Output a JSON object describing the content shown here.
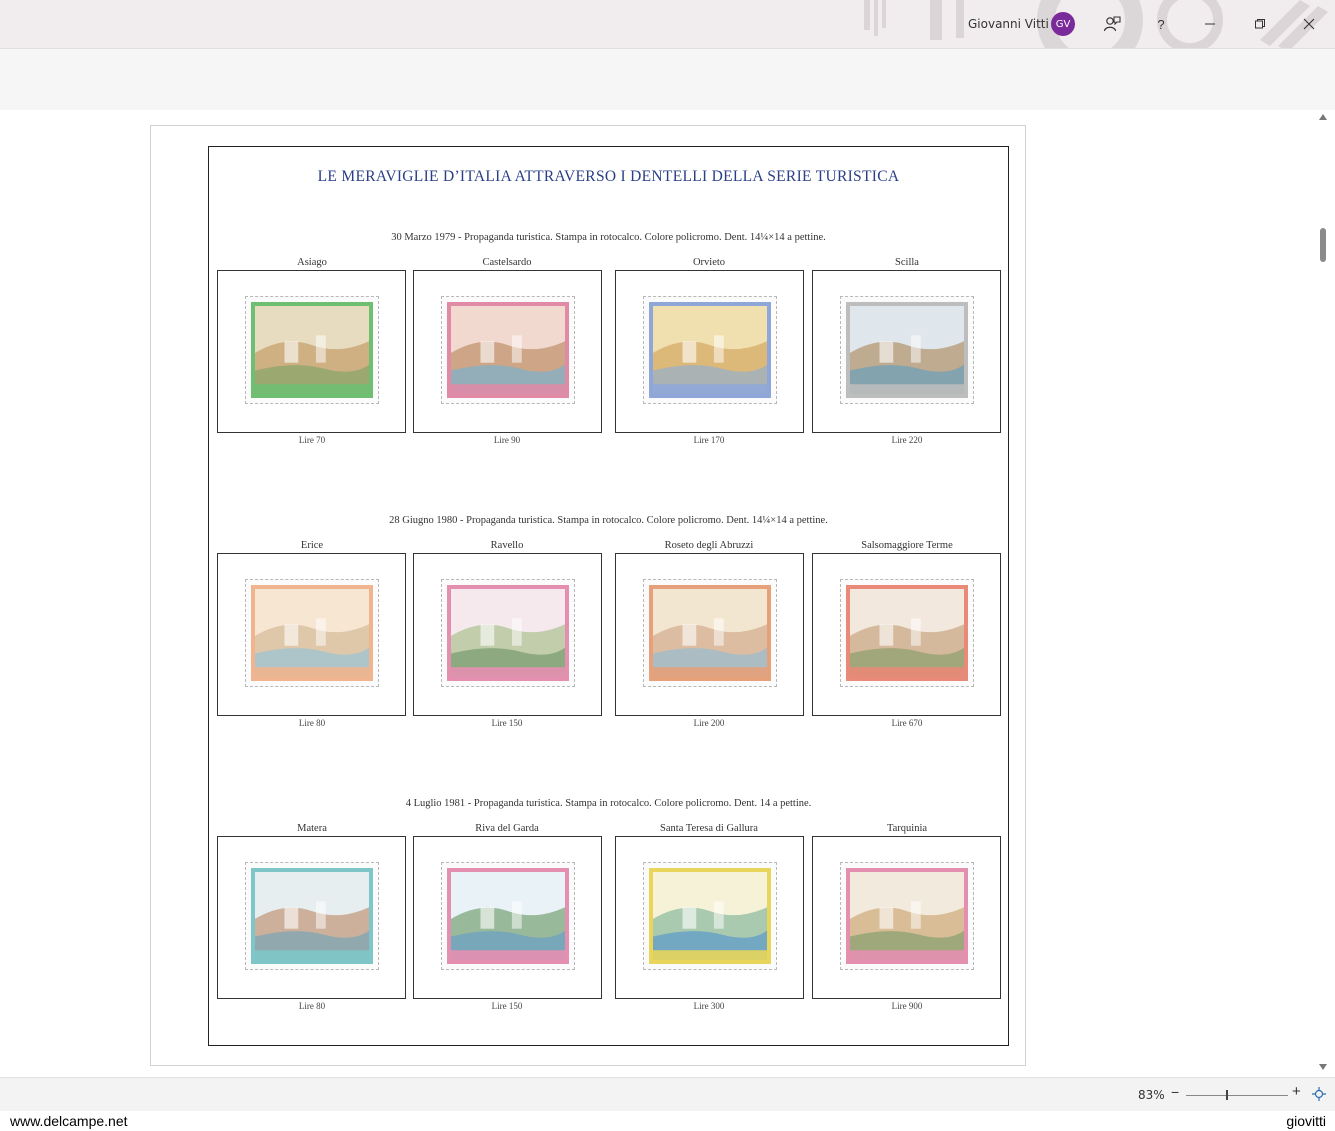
{
  "titlebar": {
    "user_name": "Giovanni Vitti",
    "avatar_initials": "GV",
    "icons": [
      "feedback-icon",
      "help-icon",
      "minimize-icon",
      "restore-icon",
      "close-icon"
    ],
    "help_glyph": "?",
    "avatar_color": "#7b2a9c"
  },
  "album": {
    "title": "LE MERAVIGLIE D’ITALIA ATTRAVERSO I DENTELLI DELLA SERIE TURISTICA",
    "title_color": "#2a3f86",
    "series": [
      {
        "caption": "30 Marzo 1979 - Propaganda turistica. Stampa in rotocalco. Colore policromo. Dent. 14¼×14 a pettine.",
        "stamps": [
          {
            "name": "Asiago",
            "value": "Lire 70",
            "frame_color": "#6fbf73"
          },
          {
            "name": "Castelsardo",
            "value": "Lire 90",
            "frame_color": "#e08aa6"
          },
          {
            "name": "Orvieto",
            "value": "Lire 170",
            "frame_color": "#8fa6d8"
          },
          {
            "name": "Scilla",
            "value": "Lire 220",
            "frame_color": "#bdbdbd"
          }
        ]
      },
      {
        "caption": "28 Giugno 1980 - Propaganda turistica. Stampa in rotocalco. Colore policromo. Dent. 14¼×14 a pettine.",
        "stamps": [
          {
            "name": "Erice",
            "value": "Lire 80",
            "frame_color": "#f0b58e"
          },
          {
            "name": "Ravello",
            "value": "Lire 150",
            "frame_color": "#e58fb0"
          },
          {
            "name": "Roseto degli Abruzzi",
            "value": "Lire 200",
            "frame_color": "#e6a07a"
          },
          {
            "name": "Salsomaggiore Terme",
            "value": "Lire 670",
            "frame_color": "#e98a78"
          }
        ]
      },
      {
        "caption": "4 Luglio 1981 - Propaganda turistica. Stampa in rotocalco. Colore policromo. Dent. 14 a pettine.",
        "stamps": [
          {
            "name": "Matera",
            "value": "Lire 80",
            "frame_color": "#7fc6c9"
          },
          {
            "name": "Riva del Garda",
            "value": "Lire 150",
            "frame_color": "#e58fb0"
          },
          {
            "name": "Santa Teresa di Gallura",
            "value": "Lire 300",
            "frame_color": "#e8d55a"
          },
          {
            "name": "Tarquinia",
            "value": "Lire 900",
            "frame_color": "#e58fb0"
          }
        ]
      }
    ]
  },
  "statusbar": {
    "zoom_percent": "83%",
    "zoom_minus": "−",
    "zoom_plus": "+"
  },
  "footer": {
    "left_text": "www.delcampe.net",
    "right_text": "giovitti"
  }
}
